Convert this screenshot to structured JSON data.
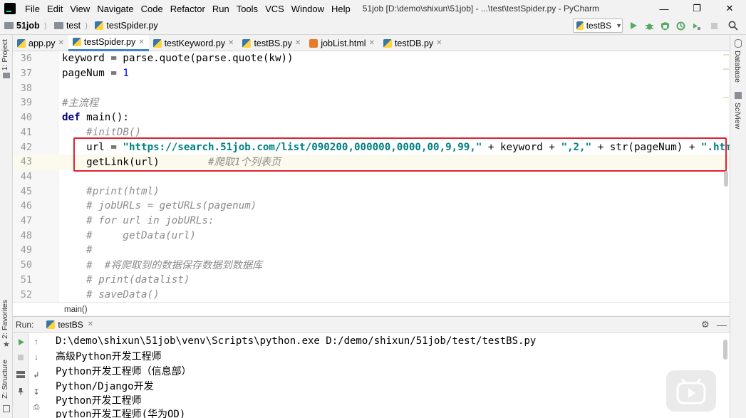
{
  "menubar": {
    "items": [
      "File",
      "Edit",
      "View",
      "Navigate",
      "Code",
      "Refactor",
      "Run",
      "Tools",
      "VCS",
      "Window",
      "Help"
    ],
    "title": "51job [D:\\demo\\shixun\\51job] - ...\\test\\testSpider.py - PyCharm"
  },
  "navbar": {
    "project": "51job",
    "folder": "test",
    "file": "testSpider.py",
    "run_config": "testBS"
  },
  "left_tabs": {
    "project": "1: Project",
    "favorites": "2: Favorites",
    "structure": "Z: Structure"
  },
  "right_tabs": {
    "database": "Database",
    "sciview": "SciView"
  },
  "editor_tabs": [
    "app.py",
    "testSpider.py",
    "testKeyword.py",
    "testBS.py",
    "jobList.html",
    "testDB.py"
  ],
  "editor": {
    "lines": [
      {
        "n": "36",
        "segs": [
          [
            "keyword = parse.quote(parse.quote(kw))",
            ""
          ]
        ]
      },
      {
        "n": "37",
        "segs": [
          [
            "pageNum = ",
            ""
          ],
          [
            "1",
            "num"
          ]
        ]
      },
      {
        "n": "38",
        "segs": []
      },
      {
        "n": "39",
        "segs": [
          [
            "#主流程",
            "cmt"
          ]
        ]
      },
      {
        "n": "40",
        "segs": [
          [
            "def",
            "kw"
          ],
          [
            " main():",
            ""
          ]
        ]
      },
      {
        "n": "41",
        "segs": [
          [
            "    ",
            ""
          ],
          [
            "#initDB()",
            "cmt"
          ]
        ]
      },
      {
        "n": "42",
        "segs": [
          [
            "    url = ",
            ""
          ],
          [
            "\"https://search.51job.com/list/090200,000000,0000,00,9,99,\"",
            "str"
          ],
          [
            " + keyword + ",
            ""
          ],
          [
            "\",2,\"",
            "str"
          ],
          [
            " + str(pageNum) + ",
            ""
          ],
          [
            "\".html\"",
            "str"
          ]
        ]
      },
      {
        "n": "43",
        "segs": [
          [
            "    getLink(url)        ",
            ""
          ],
          [
            "#爬取1个列表页",
            "cmt"
          ]
        ]
      },
      {
        "n": "44",
        "segs": []
      },
      {
        "n": "45",
        "segs": [
          [
            "    ",
            ""
          ],
          [
            "#print(html)",
            "cmt"
          ]
        ]
      },
      {
        "n": "46",
        "segs": [
          [
            "    ",
            ""
          ],
          [
            "# jobURLs = getURLs(pagenum)",
            "cmt"
          ]
        ]
      },
      {
        "n": "47",
        "segs": [
          [
            "    ",
            ""
          ],
          [
            "# for url in jobURLs:",
            "cmt"
          ]
        ]
      },
      {
        "n": "48",
        "segs": [
          [
            "    ",
            ""
          ],
          [
            "#     getData(url)",
            "cmt"
          ]
        ]
      },
      {
        "n": "49",
        "segs": [
          [
            "    ",
            ""
          ],
          [
            "#",
            "cmt"
          ]
        ]
      },
      {
        "n": "50",
        "segs": [
          [
            "    ",
            ""
          ],
          [
            "#  #将爬取到的数据保存数据到数据库",
            "cmt"
          ]
        ]
      },
      {
        "n": "51",
        "segs": [
          [
            "    ",
            ""
          ],
          [
            "# print(datalist)",
            "cmt"
          ]
        ]
      },
      {
        "n": "52",
        "segs": [
          [
            "    ",
            ""
          ],
          [
            "# saveData()",
            "cmt"
          ]
        ]
      }
    ],
    "current_line": "43",
    "breadcrumb": "main()"
  },
  "run_panel": {
    "label": "Run:",
    "tab": "testBS",
    "output": [
      "D:\\demo\\shixun\\51job\\venv\\Scripts\\python.exe D:/demo/shixun/51job/test/testBS.py",
      "高级Python开发工程师",
      "Python开发工程师（信息部）",
      "Python/Django开发",
      "Python开发工程师",
      "python开发工程师(华为OD)"
    ]
  },
  "colors": {
    "accent": "#4083c9",
    "highlight_box": "#e3202f",
    "keyword": "#000080",
    "string": "#008080",
    "comment": "#8c8c8c",
    "number": "#0000ff",
    "run_green": "#59a869"
  }
}
